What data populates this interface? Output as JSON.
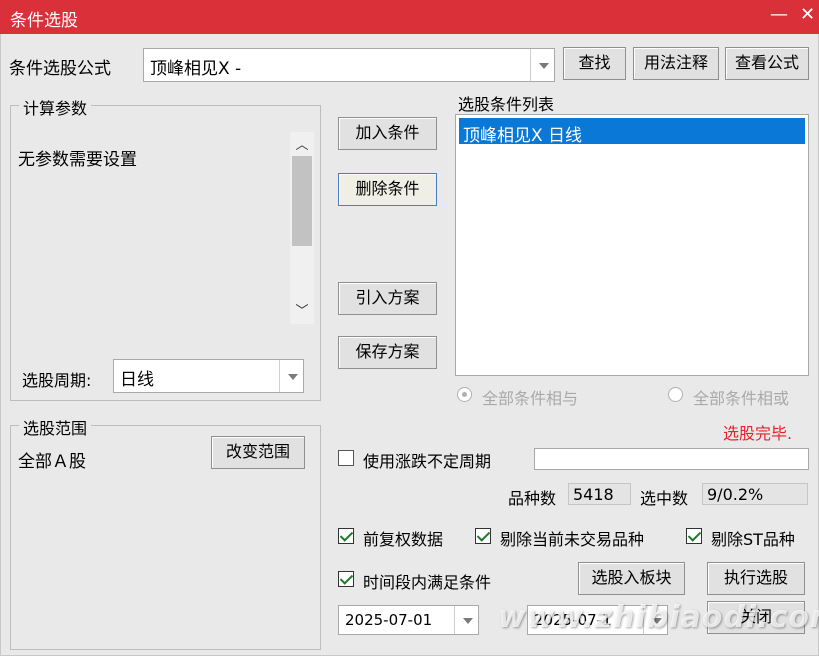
{
  "window": {
    "title": "条件选股",
    "minimize_glyph": "—",
    "close_glyph": "✕"
  },
  "formula": {
    "label": "条件选股公式",
    "value": "顶峰相见X  -",
    "buttons": {
      "find": "查找",
      "usage": "用法注释",
      "view": "查看公式"
    }
  },
  "params": {
    "legend": "计算参数",
    "message": "无参数需要设置",
    "period_label": "选股周期:",
    "period_value": "日线"
  },
  "scope": {
    "legend": "选股范围",
    "value": "全部Ａ股",
    "change_button": "改变范围"
  },
  "actions": {
    "add": "加入条件",
    "delete": "删除条件",
    "import": "引入方案",
    "save": "保存方案"
  },
  "conditions": {
    "label": "选股条件列表",
    "items": [
      "顶峰相见X  日线"
    ],
    "radio_and": "全部条件相与",
    "radio_or": "全部条件相或"
  },
  "status": {
    "text": "选股完毕.",
    "color": "#e8202a"
  },
  "variable_period": {
    "label": "使用涨跌不定周期",
    "value": ""
  },
  "stats": {
    "count_label": "品种数",
    "count_value": "5418",
    "selected_label": "选中数",
    "selected_value": "9/0.2%"
  },
  "options": {
    "forward_adjust": "前复权数据",
    "exclude_untraded": "剔除当前未交易品种",
    "exclude_st": "剔除ST品种",
    "time_range": "时间段内满足条件"
  },
  "bottom": {
    "to_block": "选股入板块",
    "execute": "执行选股",
    "close": "关闭",
    "start_date": "2025-07-01",
    "end_date": "2025-07-1"
  },
  "watermark": "www.zhibiaodi.com",
  "colors": {
    "titlebar": "#d9303a",
    "selection": "#0a78d6"
  }
}
